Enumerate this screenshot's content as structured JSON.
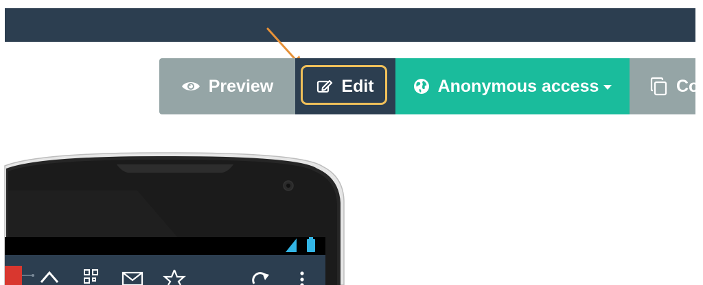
{
  "header": {},
  "toolbar": {
    "preview_label": "Preview",
    "edit_label": "Edit",
    "anonymous_label": "Anonymous access",
    "copy_label_partial": "Co",
    "icons": {
      "preview": "eye-icon",
      "edit": "edit-icon",
      "anonymous": "globe-icon",
      "copy": "copy-icon",
      "dropdown": "caret-down-icon"
    }
  },
  "colors": {
    "header_bg": "#2c3e50",
    "preview_bg": "#95a5a6",
    "edit_bg": "#2c3e50",
    "anonymous_bg": "#1abc9c",
    "highlight": "#f0c05a",
    "arrow": "#e69138"
  },
  "phone": {
    "nav_icons": [
      "home-icon",
      "qr-code-icon",
      "mail-icon",
      "star-icon",
      "refresh-icon",
      "more-icon"
    ]
  }
}
